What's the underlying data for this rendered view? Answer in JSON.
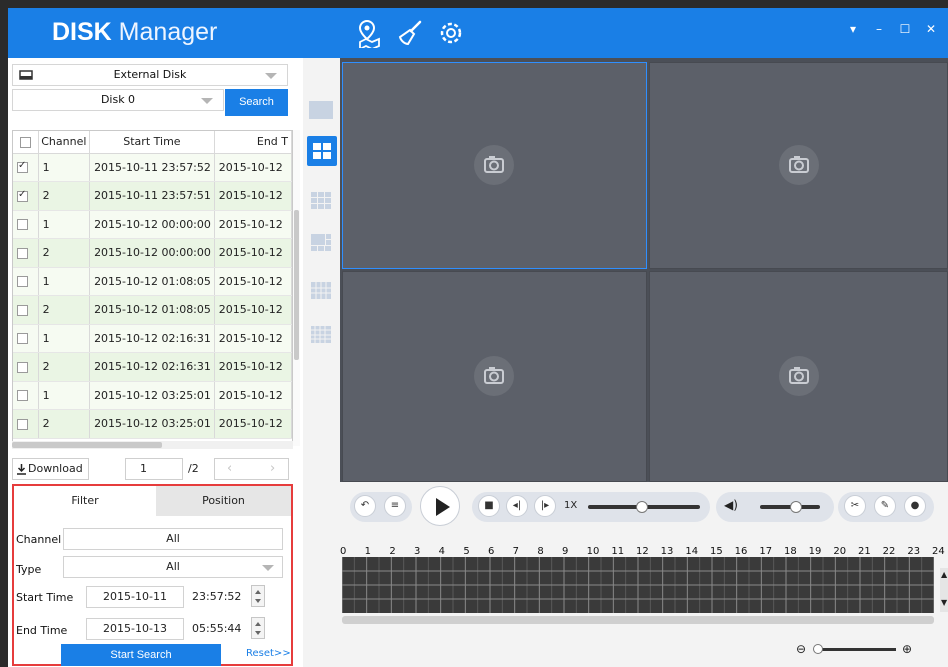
{
  "app": {
    "logo_bold": "DISK",
    "logo_rest": " Manager"
  },
  "source": {
    "disk_type": "External Disk",
    "disk_name": "Disk 0",
    "search_label": "Search"
  },
  "table": {
    "headers": [
      "Channel",
      "Start Time",
      "End T"
    ],
    "rows": [
      {
        "checked": true,
        "channel": "1",
        "start": "2015-10-11 23:57:52",
        "end": "2015-10-12"
      },
      {
        "checked": true,
        "channel": "2",
        "start": "2015-10-11 23:57:51",
        "end": "2015-10-12"
      },
      {
        "checked": false,
        "channel": "1",
        "start": "2015-10-12 00:00:00",
        "end": "2015-10-12"
      },
      {
        "checked": false,
        "channel": "2",
        "start": "2015-10-12 00:00:00",
        "end": "2015-10-12"
      },
      {
        "checked": false,
        "channel": "1",
        "start": "2015-10-12 01:08:05",
        "end": "2015-10-12"
      },
      {
        "checked": false,
        "channel": "2",
        "start": "2015-10-12 01:08:05",
        "end": "2015-10-12"
      },
      {
        "checked": false,
        "channel": "1",
        "start": "2015-10-12 02:16:31",
        "end": "2015-10-12"
      },
      {
        "checked": false,
        "channel": "2",
        "start": "2015-10-12 02:16:31",
        "end": "2015-10-12"
      },
      {
        "checked": false,
        "channel": "1",
        "start": "2015-10-12 03:25:01",
        "end": "2015-10-12"
      },
      {
        "checked": false,
        "channel": "2",
        "start": "2015-10-12 03:25:01",
        "end": "2015-10-12"
      }
    ]
  },
  "pager": {
    "download_label": "Download",
    "page": "1",
    "total": "/2"
  },
  "filter": {
    "tab_filter": "Filter",
    "tab_position": "Position",
    "channel_label": "Channel",
    "channel_value": "All",
    "type_label": "Type",
    "type_value": "All",
    "start_label": "Start Time",
    "start_date": "2015-10-11",
    "start_time": "23:57:52",
    "end_label": "End Time",
    "end_date": "2015-10-13",
    "end_time": "05:55:44",
    "search_button": "Start Search",
    "reset_link": "Reset>>"
  },
  "playback": {
    "speed": "1X",
    "progress": 0.48,
    "volume": 0.6
  },
  "timeline": {
    "hours": [
      "0",
      "1",
      "2",
      "3",
      "4",
      "5",
      "6",
      "7",
      "8",
      "9",
      "10",
      "11",
      "12",
      "13",
      "14",
      "15",
      "16",
      "17",
      "18",
      "19",
      "20",
      "21",
      "22",
      "23",
      "24"
    ],
    "zoom": 0.02
  },
  "colors": {
    "accent": "#1a7fe6",
    "filter_border": "#e63c3c",
    "video_bg": "#4b4f57",
    "row_tint": "#eaf5e4"
  }
}
